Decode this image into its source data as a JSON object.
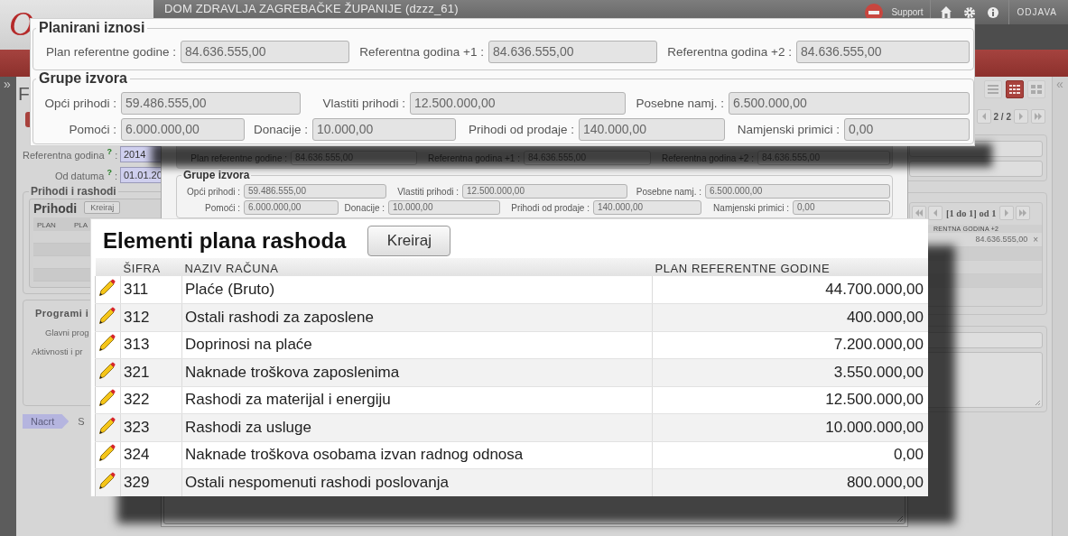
{
  "header": {
    "logo": "O",
    "title": "DOM ZDRAVLJA ZAGREBAČKE ŽUPANIJE (dzzz_61)",
    "links": [
      {
        "kind": "support",
        "label": "Support"
      },
      {
        "kind": "home"
      },
      {
        "kind": "settings"
      },
      {
        "kind": "info"
      },
      {
        "kind": "logout",
        "label": "ODJAVA"
      }
    ]
  },
  "sidebar": {
    "expand": "»"
  },
  "right_panel": {
    "collapse": "«"
  },
  "page": {
    "title": "F",
    "fields": [
      {
        "label": "Referentna godina",
        "hint": "?",
        "separator": ":",
        "value": "2014"
      },
      {
        "label": "Od datuma",
        "hint": "?",
        "separator": ":",
        "value": "01.01.20"
      }
    ],
    "income_expense": {
      "legend": "Prihodi i rashodi",
      "panel_title": "Prihodi",
      "button": "Kreiraj",
      "columns": [
        "PLAN",
        "PLA"
      ]
    },
    "programs": {
      "legend": "Programi i",
      "labels": [
        "Glavni prog",
        "Aktivnosti i pr"
      ]
    },
    "steps": [
      {
        "label": "Nacrt",
        "selected": true
      },
      {
        "label": "S",
        "selected": false
      }
    ],
    "views": [
      {
        "kind": "list",
        "selected": false
      },
      {
        "kind": "table",
        "selected": true
      },
      {
        "kind": "grid",
        "selected": false
      }
    ],
    "pager": "2 / 2",
    "grid": {
      "pager": "[1 do 1] od 1",
      "column": "RENTNA GODINA +2",
      "rows": [
        {
          "value": "84.636.555,00",
          "remove": "×"
        }
      ]
    }
  },
  "dialog": {
    "groups": [
      {
        "kind": "planned",
        "rows": [
          [
            {
              "label": "Plan referentne godine :",
              "value": "84.636.555,00"
            },
            {
              "label": "Referentna godina +1 :",
              "value": "84.636.555,00"
            },
            {
              "label": "Referentna godina +2 :",
              "value": "84.636.555,00"
            }
          ]
        ]
      },
      {
        "kind": "sources",
        "legend": "Grupe izvora",
        "rows": [
          [
            {
              "label": "Opći prihodi :",
              "value": "59.486.555,00"
            },
            {
              "label": "Vlastiti prihodi :",
              "value": "12.500.000,00"
            },
            {
              "label": "Posebne namj. :",
              "value": "6.500.000,00"
            }
          ],
          [
            {
              "label": "Pomoći :",
              "value": "6.000.000,00"
            },
            {
              "label": "Donacije :",
              "value": "10.000,00"
            },
            {
              "label": "Prihodi od prodaje :",
              "value": "140.000,00"
            },
            {
              "label": "Namjenski primici :",
              "value": "0,00"
            }
          ]
        ]
      }
    ]
  },
  "zoom_amounts": {
    "groups": [
      {
        "kind": "planned",
        "legend": "Planirani iznosi",
        "rows": [
          [
            {
              "label": "Plan referentne godine :",
              "value": "84.636.555,00"
            },
            {
              "label": "Referentna godina +1 :",
              "value": "84.636.555,00"
            },
            {
              "label": "Referentna godina +2 :",
              "value": "84.636.555,00"
            }
          ]
        ]
      },
      {
        "kind": "sources",
        "legend": "Grupe izvora",
        "rows": [
          [
            {
              "label": "Opći prihodi :",
              "value": "59.486.555,00"
            },
            {
              "label": "Vlastiti prihodi :",
              "value": "12.500.000,00"
            },
            {
              "label": "Posebne namj. :",
              "value": "6.500.000,00"
            }
          ],
          [
            {
              "label": "Pomoći :",
              "value": "6.000.000,00"
            },
            {
              "label": "Donacije :",
              "value": "10.000,00"
            },
            {
              "label": "Prihodi od prodaje :",
              "value": "140.000,00"
            },
            {
              "label": "Namjenski primici :",
              "value": "0,00"
            }
          ]
        ]
      }
    ]
  },
  "zoom_table": {
    "title": "Elementi plana rashoda",
    "button": "Kreiraj",
    "columns": [
      "ŠIFRA",
      "NAZIV RAČUNA",
      "PLAN REFERENTNE GODINE"
    ],
    "rows": [
      {
        "code": "311",
        "name": "Plaće (Bruto)",
        "amount": "44.700.000,00"
      },
      {
        "code": "312",
        "name": "Ostali rashodi za zaposlene",
        "amount": "400.000,00"
      },
      {
        "code": "313",
        "name": "Doprinosi na plaće",
        "amount": "7.200.000,00"
      },
      {
        "code": "321",
        "name": "Naknade troškova zaposlenima",
        "amount": "3.550.000,00"
      },
      {
        "code": "322",
        "name": "Rashodi za materijal i energiju",
        "amount": "12.500.000,00"
      },
      {
        "code": "323",
        "name": "Rashodi za usluge",
        "amount": "10.000.000,00"
      },
      {
        "code": "324",
        "name": "Naknade troškova osobama izvan radnog odnosa",
        "amount": "0,00"
      },
      {
        "code": "329",
        "name": "Ostali nespomenuti rashodi poslovanja",
        "amount": "800.000,00"
      }
    ]
  }
}
